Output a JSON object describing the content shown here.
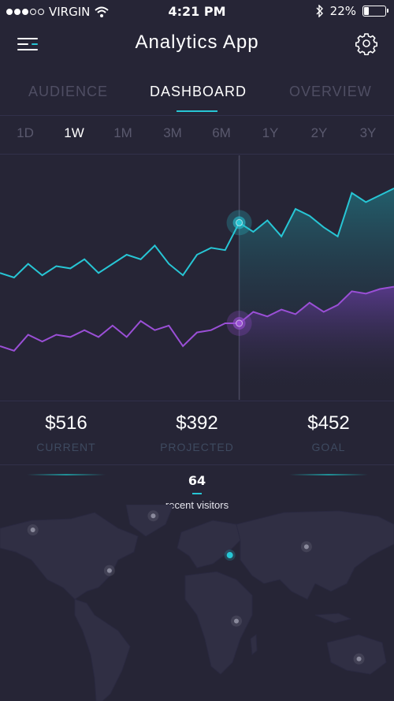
{
  "status_bar": {
    "carrier": "VIRGIN",
    "time": "4:21 PM",
    "battery": "22%",
    "battery_level": 0.22,
    "icons": [
      "signal-dots-icon",
      "wifi-icon",
      "bluetooth-icon",
      "battery-icon"
    ]
  },
  "header": {
    "title": "Analytics App",
    "menu_icon": "menu-icon",
    "settings_icon": "gear-icon"
  },
  "tabs": [
    {
      "label": "AUDIENCE",
      "active": false
    },
    {
      "label": "DASHBOARD",
      "active": true
    },
    {
      "label": "OVERVIEW",
      "active": false
    }
  ],
  "ranges": [
    {
      "label": "1D",
      "active": false
    },
    {
      "label": "1W",
      "active": true
    },
    {
      "label": "1M",
      "active": false
    },
    {
      "label": "3M",
      "active": false
    },
    {
      "label": "6M",
      "active": false
    },
    {
      "label": "1Y",
      "active": false
    },
    {
      "label": "2Y",
      "active": false
    },
    {
      "label": "3Y",
      "active": false
    }
  ],
  "stats": [
    {
      "value": "$516",
      "label": "CURRENT"
    },
    {
      "value": "$392",
      "label": "PROJECTED"
    },
    {
      "value": "$452",
      "label": "GOAL"
    }
  ],
  "visitors": {
    "count": "64",
    "label": "recent visitors"
  },
  "colors": {
    "background": "#262536",
    "accent_cyan": "#27c6d5",
    "accent_purple": "#9a4fd6",
    "map_land": "#302f44",
    "muted_text": "#4f4e63"
  },
  "chart_data": {
    "type": "area",
    "title": "",
    "xlabel": "",
    "ylabel": "",
    "ylim": [
      0,
      100
    ],
    "series": [
      {
        "color": "#27c6d5",
        "values": [
          52,
          50,
          56,
          51,
          55,
          54,
          58,
          52,
          56,
          60,
          58,
          64,
          56,
          51,
          60,
          63,
          62,
          74,
          70,
          75,
          68,
          80,
          77,
          72,
          68,
          87,
          83,
          86,
          89
        ]
      },
      {
        "color": "#9a4fd6",
        "values": [
          20,
          18,
          25,
          22,
          25,
          24,
          27,
          24,
          29,
          24,
          31,
          27,
          29,
          20,
          26,
          27,
          30,
          30,
          35,
          33,
          36,
          34,
          39,
          35,
          38,
          44,
          43,
          45,
          46
        ]
      }
    ],
    "cursor_index": 17,
    "grid": false,
    "legend": "none"
  },
  "map_markers": [
    {
      "lon": -150,
      "lat": 62,
      "highlight": false
    },
    {
      "lon": -40,
      "lat": 72,
      "highlight": false
    },
    {
      "lon": -80,
      "lat": 33,
      "highlight": false
    },
    {
      "lon": 30,
      "lat": 44,
      "highlight": true
    },
    {
      "lon": 100,
      "lat": 50,
      "highlight": false
    },
    {
      "lon": 36,
      "lat": -3,
      "highlight": false
    },
    {
      "lon": 148,
      "lat": -30,
      "highlight": false
    }
  ]
}
